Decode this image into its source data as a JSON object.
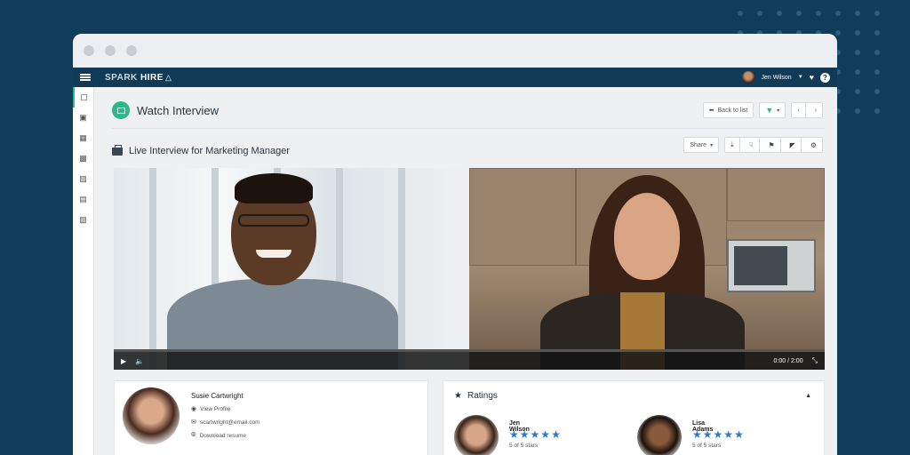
{
  "app": {
    "logo_prefix": "SPARK",
    "logo_suffix": "HIRE",
    "user_name": "Jen Wilson"
  },
  "sidebar": {
    "items": [
      {
        "name": "video-interviews",
        "icon": "video-icon"
      },
      {
        "name": "jobs",
        "icon": "briefcase-icon"
      },
      {
        "name": "calendar",
        "icon": "calendar-icon"
      },
      {
        "name": "candidates",
        "icon": "people-icon"
      },
      {
        "name": "library",
        "icon": "folder-icon"
      },
      {
        "name": "reports",
        "icon": "chart-icon"
      },
      {
        "name": "integrations",
        "icon": "plug-icon"
      }
    ]
  },
  "page": {
    "title": "Watch Interview",
    "back_label": "Back to list",
    "section_title": "Live Interview for Marketing Manager",
    "share_label": "Share"
  },
  "video": {
    "time_current": "0:00",
    "time_sep": "/",
    "time_total": "2:00",
    "progress": 0
  },
  "candidate": {
    "name": "Susie Cartwright",
    "view_profile": "View Profile",
    "email": "scartwright@email.com",
    "resume": "Download resume"
  },
  "ratings": {
    "title": "Ratings",
    "raters": [
      {
        "name": "Jen Wilson",
        "stars": 5,
        "summary": "5 of 5 stars"
      },
      {
        "name": "Lisa Adams",
        "stars": 5,
        "summary": "5 of 5 stars"
      }
    ]
  },
  "colors": {
    "background": "#0f3d5a",
    "appbar": "#103a56",
    "accent": "#2eb88a",
    "star": "#2f79c9"
  }
}
